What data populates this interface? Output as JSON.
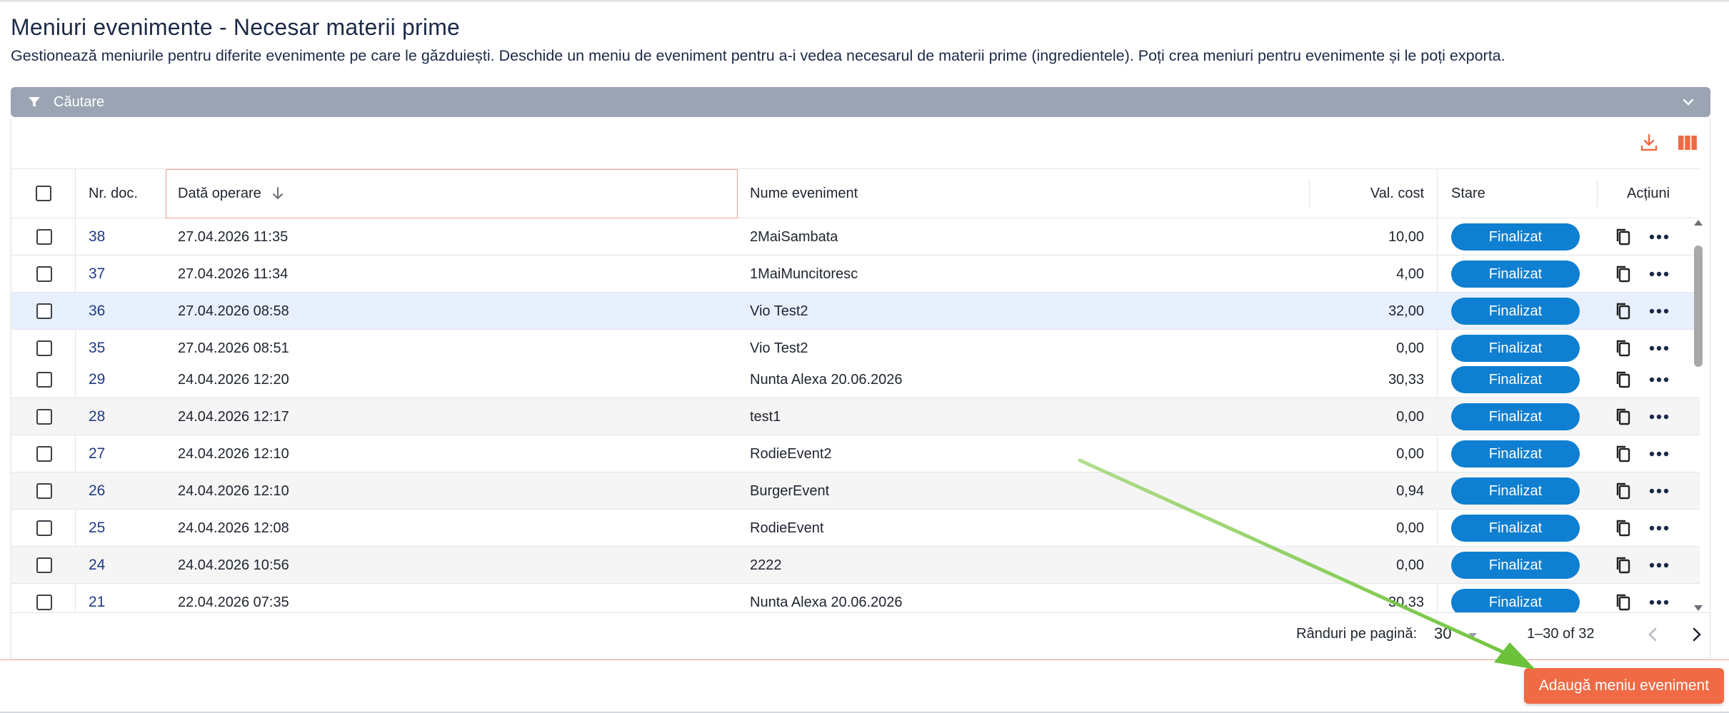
{
  "header": {
    "title": "Meniuri evenimente - Necesar materii prime",
    "description": "Gestionează meniurile pentru diferite evenimente pe care le găzduiești. Deschide un meniu de eveniment pentru a-i vedea necesarul de materii prime (ingredientele). Poți crea meniuri pentru evenimente și le poți exporta."
  },
  "filter": {
    "label": "Căutare"
  },
  "table": {
    "columns": {
      "nr": "Nr. doc.",
      "date": "Dată operare",
      "name": "Nume eveniment",
      "value": "Val. cost",
      "status": "Stare",
      "actions": "Acțiuni"
    },
    "rows": [
      {
        "nr": "38",
        "date": "27.04.2026 11:35",
        "name": "2MaiSambata",
        "value": "10,00",
        "status": "Finalizat"
      },
      {
        "nr": "37",
        "date": "27.04.2026 11:34",
        "name": "1MaiMuncitoresc",
        "value": "4,00",
        "status": "Finalizat"
      },
      {
        "nr": "36",
        "date": "27.04.2026 08:58",
        "name": "Vio Test2",
        "value": "32,00",
        "status": "Finalizat"
      },
      {
        "nr": "35",
        "date": "27.04.2026 08:51",
        "name": "Vio Test2",
        "value": "0,00",
        "status": "Finalizat"
      },
      {
        "nr": "29",
        "date": "24.04.2026 12:20",
        "name": "Nunta Alexa 20.06.2026",
        "value": "30,33",
        "status": "Finalizat"
      },
      {
        "nr": "28",
        "date": "24.04.2026 12:17",
        "name": "test1",
        "value": "0,00",
        "status": "Finalizat"
      },
      {
        "nr": "27",
        "date": "24.04.2026 12:10",
        "name": "RodieEvent2",
        "value": "0,00",
        "status": "Finalizat"
      },
      {
        "nr": "26",
        "date": "24.04.2026 12:10",
        "name": "BurgerEvent",
        "value": "0,94",
        "status": "Finalizat"
      },
      {
        "nr": "25",
        "date": "24.04.2026 12:08",
        "name": "RodieEvent",
        "value": "0,00",
        "status": "Finalizat"
      },
      {
        "nr": "24",
        "date": "24.04.2026 10:56",
        "name": "2222",
        "value": "0,00",
        "status": "Finalizat"
      },
      {
        "nr": "21",
        "date": "22.04.2026 07:35",
        "name": "Nunta Alexa 20.06.2026",
        "value": "30,33",
        "status": "Finalizat"
      }
    ]
  },
  "pagination": {
    "rows_per_page_label": "Rânduri pe pagină:",
    "rows_per_page": "30",
    "range": "1–30 of 32"
  },
  "actions": {
    "add_label": "Adaugă meniu eveniment"
  },
  "colors": {
    "accent": "#f06b45",
    "status_blue": "#0f7fd1",
    "link_blue": "#1e3a8a",
    "filter_bar": "#9aa4b3",
    "annotation_arrow": "#7cc243"
  },
  "icons": {
    "filter": "funnel-icon",
    "expand": "chevron-down-icon",
    "download": "download-icon",
    "columns": "columns-icon",
    "sort": "arrow-down-icon",
    "copy": "copy-icon",
    "more": "more-horizontal-icon"
  }
}
